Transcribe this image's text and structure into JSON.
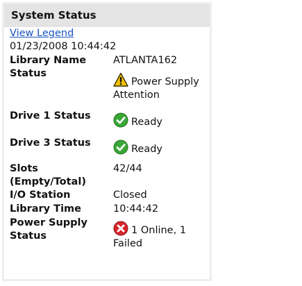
{
  "panel": {
    "title": "System Status",
    "legend_link": "View Legend",
    "timestamp": "01/23/2008 10:44:42"
  },
  "rows": {
    "library_name": {
      "label": "Library Name",
      "value": "ATLANTA162"
    },
    "status": {
      "label": "Status",
      "value": "Power Supply Attention",
      "icon": "warning-icon"
    },
    "drive1": {
      "label": "Drive 1 Status",
      "value": "Ready",
      "icon": "check-icon"
    },
    "drive3": {
      "label": "Drive 3 Status",
      "value": "Ready",
      "icon": "check-icon"
    },
    "slots": {
      "label": "Slots (Empty/Total)",
      "value": "42/44"
    },
    "io_station": {
      "label": "I/O Station",
      "value": "Closed"
    },
    "library_time": {
      "label": "Library Time",
      "value": "10:44:42"
    },
    "power_supply": {
      "label": "Power Supply Status",
      "value": "1 Online, 1 Failed",
      "icon": "error-icon"
    }
  },
  "colors": {
    "header_bg": "#e4e4e4",
    "link": "#1a55c0",
    "warning": "#f5c400",
    "ok": "#3aa635",
    "error": "#d8262d"
  }
}
